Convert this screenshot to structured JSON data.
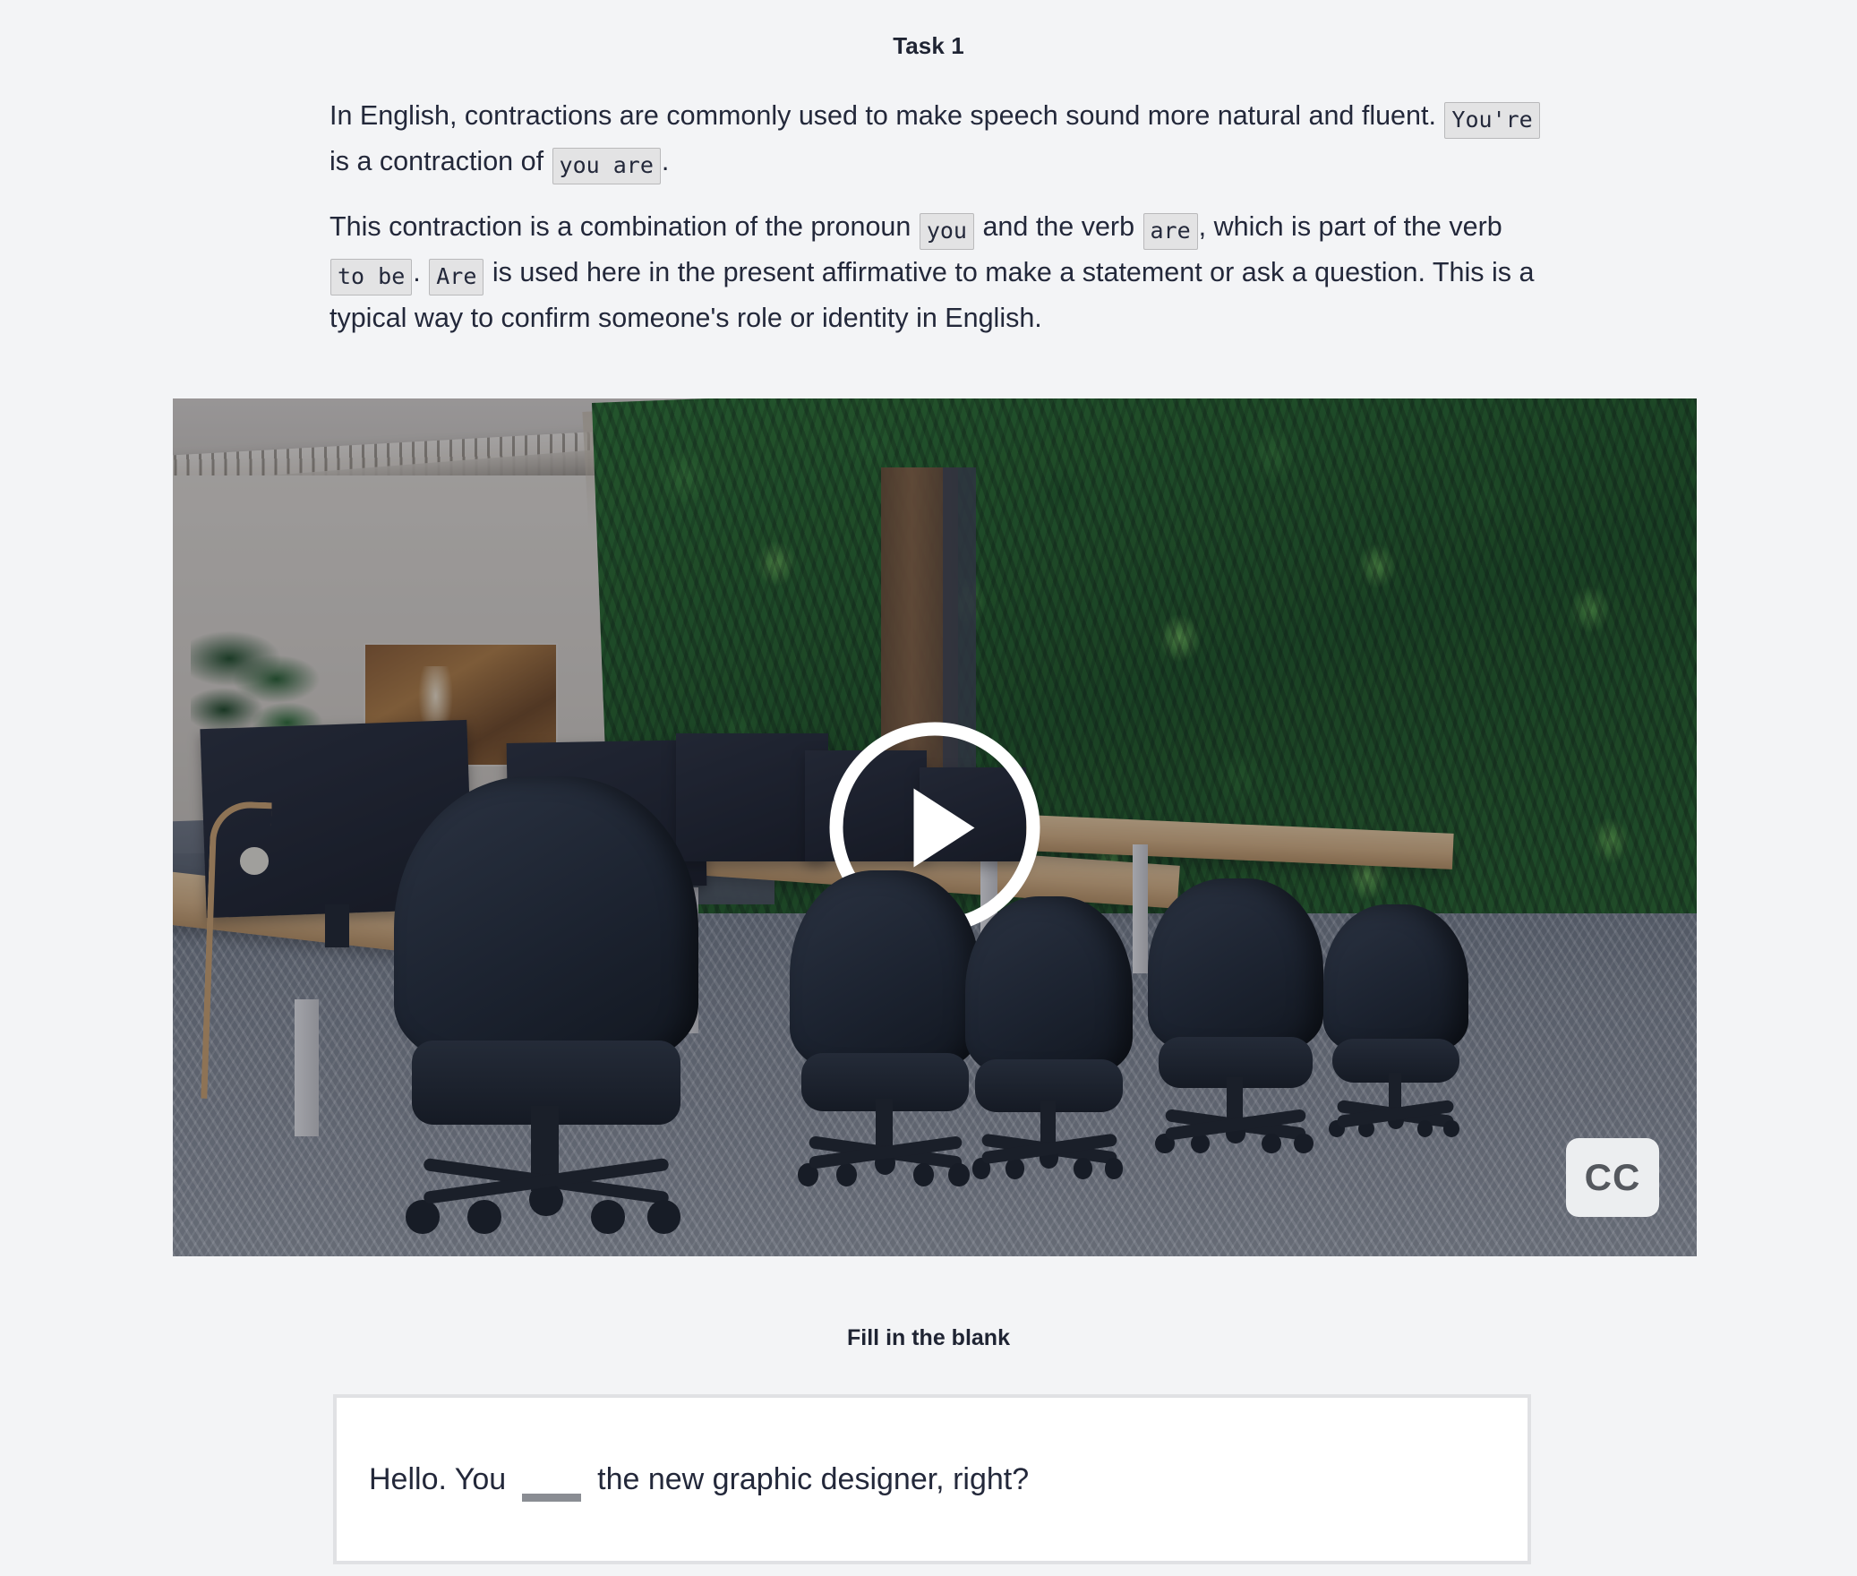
{
  "task": {
    "title": "Task 1"
  },
  "explanation": {
    "p1_part1": "In English, contractions are commonly used to make speech sound more natural and fluent. ",
    "p1_code1": "You're",
    "p1_part2": " is a contraction of ",
    "p1_code2": "you are",
    "p1_part3": ".",
    "p2_part1": "This contraction is a combination of the pronoun ",
    "p2_code1": "you",
    "p2_part2": " and the verb ",
    "p2_code2": "are",
    "p2_part3": ", which is part of the verb ",
    "p2_code3": "to be",
    "p2_part4": ". ",
    "p2_code4": "Are",
    "p2_part5": " is used here in the present affirmative to make a statement or ask a question. This is a typical way to confirm someone's role or identity in English."
  },
  "video": {
    "play_label": "play-button",
    "cc_label": "CC",
    "scene_description": "Modern open-plan office with desks, monitors, black ergonomic chairs and a green living plant wall"
  },
  "exercise": {
    "heading": "Fill in the blank",
    "sentence_before": "Hello. You",
    "blank_value": "",
    "sentence_after": "the new graphic designer, right?"
  },
  "colors": {
    "page_background": "#f3f4f6",
    "text": "#23283a",
    "code_background": "#e3e3e4",
    "code_border": "#b9b9bb",
    "answer_box_border": "#e0e1e4",
    "blank_underline": "#8a8d93",
    "cc_background": "#eceef0",
    "cc_text": "#54585e"
  }
}
